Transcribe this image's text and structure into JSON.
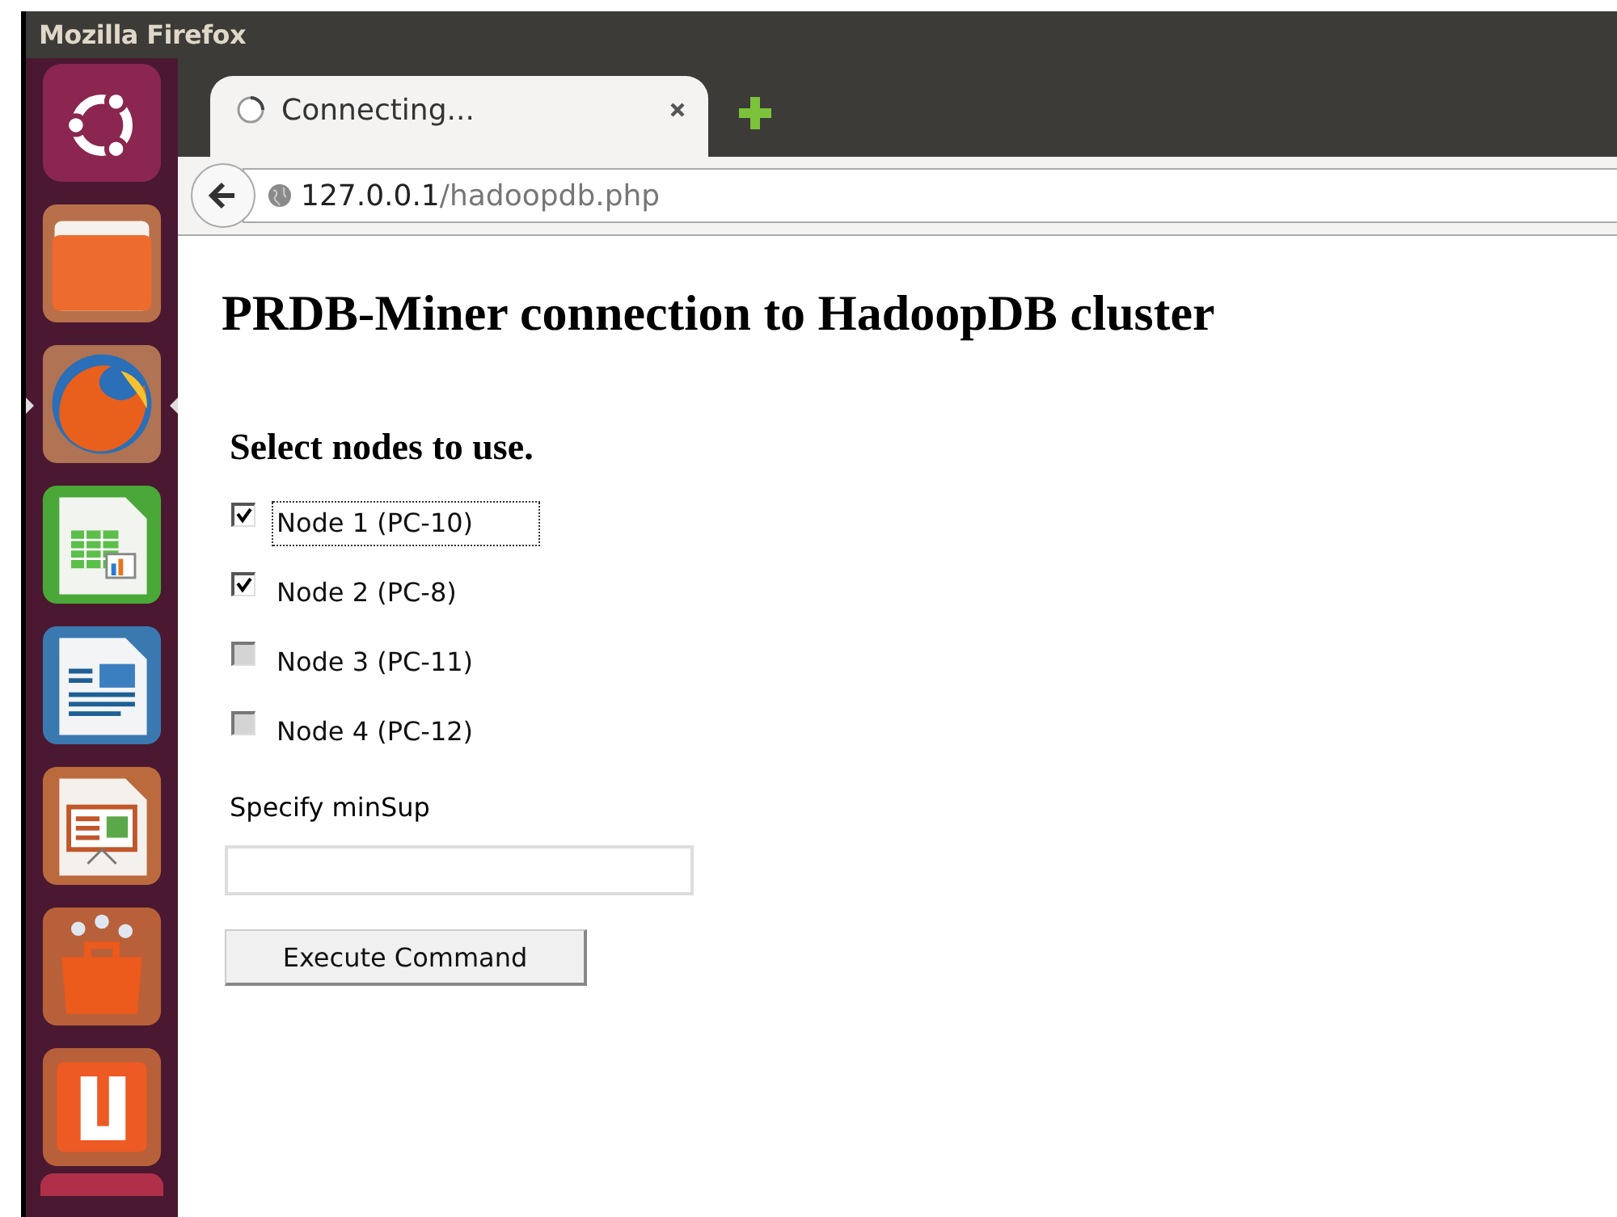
{
  "window": {
    "title": "Mozilla Firefox"
  },
  "launcher": [
    {
      "kind": "ubuntu",
      "active": false
    },
    {
      "kind": "folder",
      "active": false
    },
    {
      "kind": "firefox",
      "active": true
    },
    {
      "kind": "spreadsheet",
      "active": false
    },
    {
      "kind": "document",
      "active": false
    },
    {
      "kind": "presentation",
      "active": false
    },
    {
      "kind": "bag",
      "active": false
    },
    {
      "kind": "u",
      "active": false
    }
  ],
  "tabs": [
    {
      "label": "Connecting...",
      "loading": true,
      "selected": true
    }
  ],
  "address_bar": {
    "host": "127.0.0.1",
    "path": "/hadoopdb.php"
  },
  "page": {
    "heading": "PRDB-Miner connection to HadoopDB cluster",
    "subheading": "Select nodes to use.",
    "nodes": [
      {
        "label": "Node 1 (PC-10)",
        "checked": true,
        "disabled": false,
        "focused": true
      },
      {
        "label": "Node 2 (PC-8)",
        "checked": true,
        "disabled": false,
        "focused": false
      },
      {
        "label": "Node 3 (PC-11)",
        "checked": false,
        "disabled": true,
        "focused": false
      },
      {
        "label": "Node 4 (PC-12)",
        "checked": false,
        "disabled": true,
        "focused": false
      }
    ],
    "minsup_label": "Specify minSup",
    "button": "Execute Command"
  }
}
